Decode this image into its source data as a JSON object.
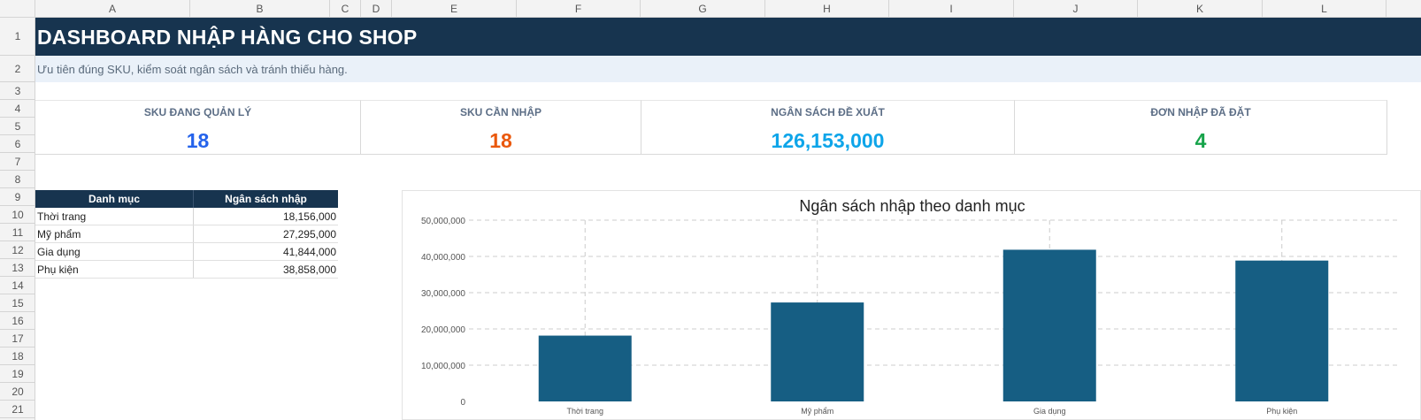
{
  "sheet": {
    "columns": [
      "A",
      "B",
      "C",
      "D",
      "E",
      "F",
      "G",
      "H",
      "I",
      "J",
      "K",
      "L"
    ],
    "rows": [
      "1",
      "2",
      "3",
      "4",
      "5",
      "6",
      "7",
      "8",
      "9",
      "10",
      "11",
      "12",
      "13",
      "14",
      "15",
      "16",
      "17",
      "18",
      "19",
      "20",
      "21"
    ]
  },
  "dashboard": {
    "title": "DASHBOARD NHẬP HÀNG CHO SHOP",
    "subtitle": "Ưu tiên đúng SKU, kiểm soát ngân sách và tránh thiếu hàng."
  },
  "kpis": [
    {
      "label": "SKU ĐANG QUẢN LÝ",
      "value": "18",
      "color": "#2563eb"
    },
    {
      "label": "SKU CẦN NHẬP",
      "value": "18",
      "color": "#ea580c"
    },
    {
      "label": "NGÂN SÁCH ĐỀ XUẤT",
      "value": "126,153,000",
      "color": "#0ea5e9"
    },
    {
      "label": "ĐƠN NHẬP ĐÃ ĐẶT",
      "value": "4",
      "color": "#16a34a"
    }
  ],
  "budget_table": {
    "headers": [
      "Danh mục",
      "Ngân sách nhập"
    ],
    "rows": [
      {
        "category": "Thời trang",
        "budget": "18,156,000"
      },
      {
        "category": "Mỹ phẩm",
        "budget": "27,295,000"
      },
      {
        "category": "Gia dụng",
        "budget": "41,844,000"
      },
      {
        "category": "Phụ kiện",
        "budget": "38,858,000"
      }
    ]
  },
  "chart_data": {
    "type": "bar",
    "title": "Ngân sách nhập theo danh mục",
    "categories": [
      "Thời trang",
      "Mỹ phẩm",
      "Gia dụng",
      "Phụ kiện"
    ],
    "values": [
      18156000,
      27295000,
      41844000,
      38858000
    ],
    "yticks": [
      "0",
      "10,000,000",
      "20,000,000",
      "30,000,000",
      "40,000,000",
      "50,000,000"
    ],
    "ylim": [
      0,
      50000000
    ],
    "grid": true,
    "bar_color": "#165e83"
  }
}
